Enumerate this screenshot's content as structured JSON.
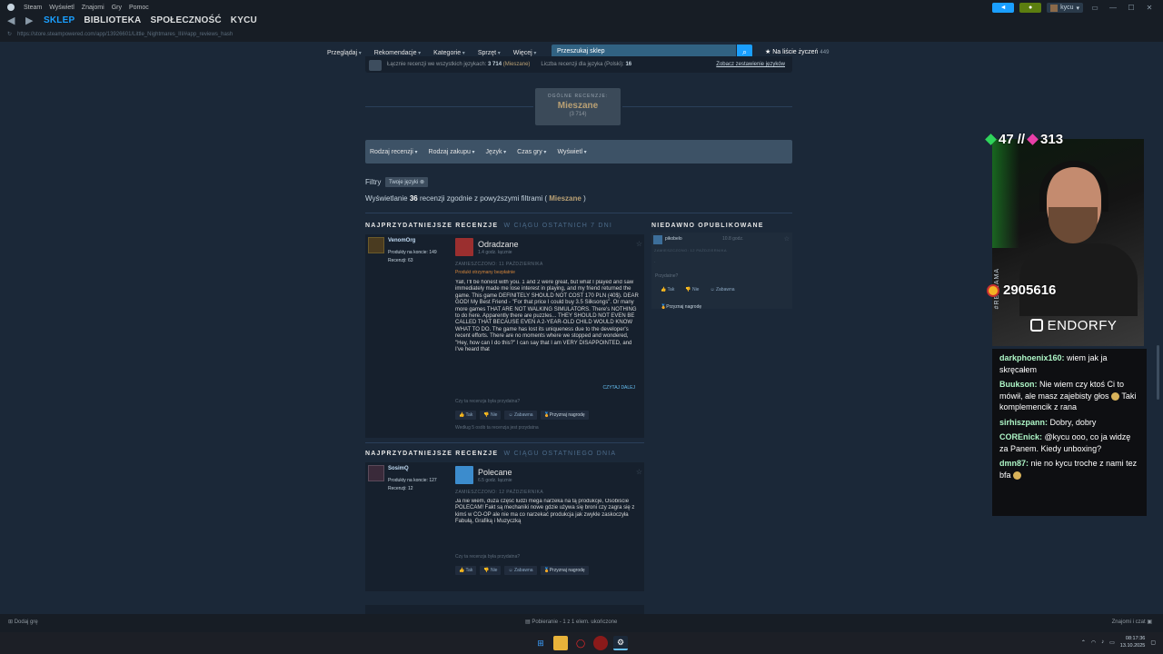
{
  "client": {
    "menu": [
      "Steam",
      "Wyświetl",
      "Znajomi",
      "Gry",
      "Pomoc"
    ],
    "tabs": [
      "SKLEP",
      "BIBLIOTEKA",
      "SPOŁECZNOŚĆ",
      "KYCU"
    ],
    "url": "https://store.steampowered.com/app/13926601/Little_Nightmares_III/#app_reviews_hash",
    "user": "kycu",
    "colors": {
      "accent": "#1a9fff",
      "mixed": "#b9a074",
      "bg": "#1b2838"
    }
  },
  "store_nav": {
    "items": [
      "Przeglądaj",
      "Rekomendacje",
      "Kategorie",
      "Sprzęt",
      "Więcej"
    ],
    "search_placeholder": "Przeszukaj sklep",
    "wishlist_label": "Na liście życzeń",
    "wishlist_count": "449"
  },
  "summary": {
    "all_langs_label": "Łącznie recenzji we wszystkich językach:",
    "all_langs_value": "3 714",
    "all_langs_rating": "(Mieszane)",
    "lang_label": "Liczba recenzji dla języka (Polski):",
    "lang_value": "16",
    "see_all": "Zobacz zestawienie języków"
  },
  "overall": {
    "label": "OGÓLNE RECENZJE:",
    "rating": "Mieszane",
    "count": "(3 714)"
  },
  "filters": {
    "bar": [
      "Rodzaj recenzji",
      "Rodzaj zakupu",
      "Język",
      "Czas gry",
      "Wyświetl"
    ],
    "label": "Filtry",
    "chip": "Twoje języki",
    "showing_pre": "Wyświetlanie",
    "showing_count": "36",
    "showing_mid": "recenzji zgodnie z powyższymi filtrami (",
    "showing_rating": "Mieszane",
    "showing_post": ")"
  },
  "section1": {
    "title": "NAJPRZYDATNIEJSZE RECENZJE",
    "sub": "W CIĄGU OSTATNICH 7 DNI"
  },
  "section2": {
    "title": "NAJPRZYDATNIEJSZE RECENZJE",
    "sub": "W CIĄGU OSTATNIEGO DNIA"
  },
  "recent_title": "NIEDAWNO OPUBLIKOWANE",
  "review1": {
    "author": "VenomOrg",
    "products_label": "Produkty na koncie:",
    "products": "149",
    "reviews_label": "Recenzji:",
    "reviews": "63",
    "verdict": "Odradzane",
    "hours": "1.4 godz. łącznie",
    "date": "ZAMIESZCZONO: 11 PAŹDZIERNIKA",
    "free": "Produkt otrzymany bezpłatnie",
    "text": "Yall, I'll be honest with you. 1 and 2 were great, but what I played and saw immediately made me lose interest in playing, and my friend returned the game. This game DEFINITELY SHOULD NOT COST 170 PLN (40$). DEAR GOD! My Best Friend - \"For that price I could buy 3.5 Silksongs\". Or many more games THAT ARE NOT WALKING SIMULATORS. There's NOTHING to do here. Apparently there are puzzles... THEY SHOULD NOT EVEN BE CALLED THAT BECAUSE EVEN A 2-YEAR-OLD CHILD WOULD KNOW WHAT TO DO. The game has lost its uniqueness due to the developer's recent efforts. There are no moments where we stopped and wondered, \"Hey, how can I do this?\" I can say that I am VERY DISAPPOINTED, and I've heard that",
    "read_more": "CZYTAJ DALEJ",
    "helpful_q": "Czy ta recenzja była przydatna?",
    "btn_yes": "Tak",
    "btn_no": "Nie",
    "btn_funny": "Zabawna",
    "btn_award": "Przyznaj nagrodę",
    "footer": "Według 5 osób ta recenzja jest przydatna"
  },
  "review2": {
    "author": "SosimQ",
    "products_label": "Produkty na koncie:",
    "products": "127",
    "reviews_label": "Recenzji:",
    "reviews": "12",
    "verdict": "Polecane",
    "hours": "6.5 godz. łącznie",
    "date": "ZAMIESZCZONO: 12 PAŹDZIERNIKA",
    "text": "Ja nie wiem, duża część ludzi mega narzeka na tą produkcje, Osobiście POLECAM! Fakt są mechaniki nowe gdzie używa się broni czy zagra się z kimś w CO-OP ale nie ma co narzekać produkcja jak zwykle zaskoczyła Fabułą, Grafiką i Muzyczką",
    "helpful_q": "Czy ta recenzja była przydatna?",
    "btn_yes": "Tak",
    "btn_no": "Nie",
    "btn_funny": "Zabawna",
    "btn_award": "Przyznaj nagrodę"
  },
  "recent": {
    "author": "pikobelo",
    "hours": "10.8 godz.",
    "date": "ZAMIESZCZONO: 12 PAŹDZIERNIKA",
    "dot": ".",
    "helpful_q": "Przydatne?",
    "btn_yes": "Tak",
    "btn_no": "Nie",
    "btn_funny": "Zabawna",
    "btn_award": "Przyznaj nagrodę"
  },
  "stream": {
    "count_a": "47",
    "sep": "//",
    "count_b": "313",
    "score": "2905616",
    "vertical": "#REKLAMA",
    "sponsor": "ENDORFY",
    "chat": [
      {
        "nick": "darkphoenix160:",
        "text": "wiem jak ja skręcałem"
      },
      {
        "nick": "Buukson:",
        "text": "Nie wiem czy ktoś Ci to mówił, ale masz zajebisty głos",
        "emote": true,
        "text2": "Taki komplemencik z rana"
      },
      {
        "nick": "sirhiszpann:",
        "text": "Dobry, dobry"
      },
      {
        "nick": "COREnick:",
        "text": "@kycu ooo, co ja widzę za Panem. Kiedy unboxing?"
      },
      {
        "nick": "dmn87:",
        "text": "nie no kycu troche z nami tez bfa",
        "emote": true
      }
    ]
  },
  "status": {
    "add_game": "Dodaj grę",
    "download": "Pobieranie - 1 z 1 elem. ukończone",
    "friends": "Znajomi i czat"
  },
  "taskbar": {
    "time": "08:17:36",
    "date": "13.10.2025"
  }
}
